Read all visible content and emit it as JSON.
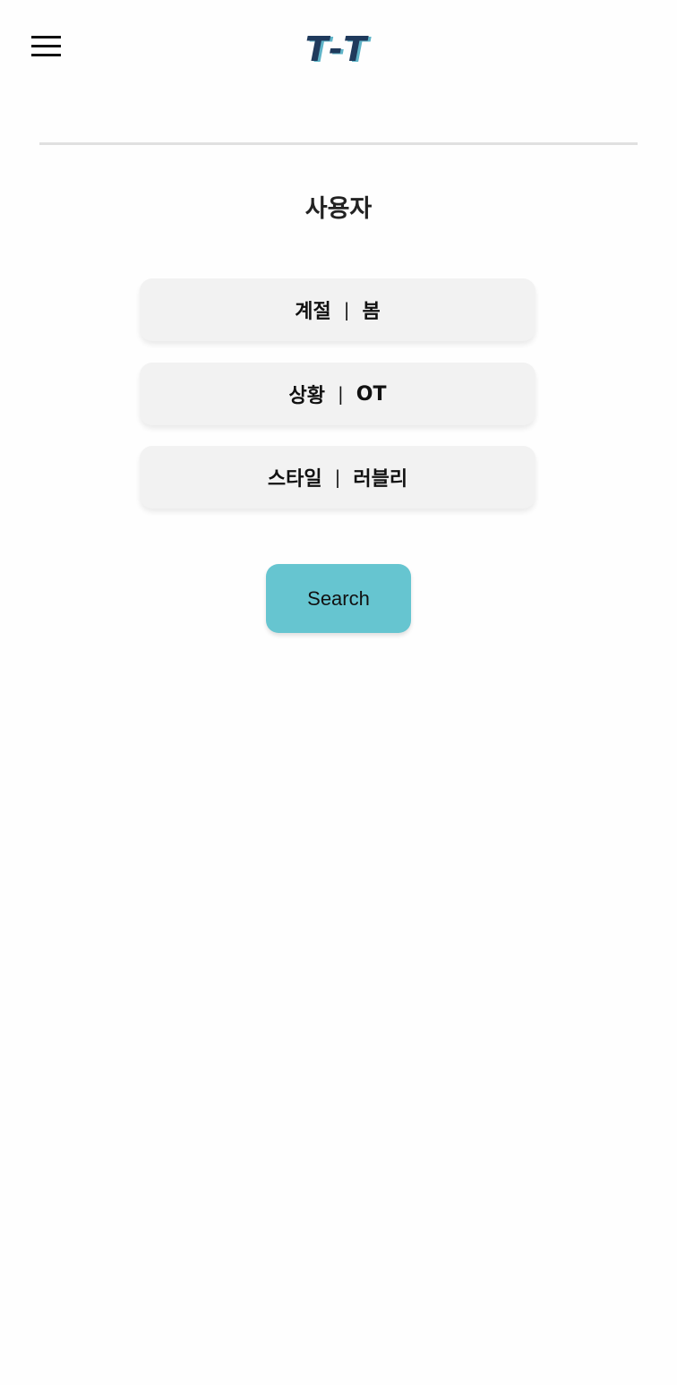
{
  "header": {
    "menu_icon": "hamburger-menu-icon",
    "logo_text": "T-T",
    "logo_colors": {
      "primary": "#1f3a5c",
      "shadow": "#5fb4c8"
    }
  },
  "page": {
    "title": "사용자"
  },
  "filters": [
    {
      "label": "계절",
      "separator": "|",
      "value": "봄"
    },
    {
      "label": "상황",
      "separator": "|",
      "value": "OT"
    },
    {
      "label": "스타일",
      "separator": "|",
      "value": "러블리"
    }
  ],
  "search": {
    "label": "Search",
    "color": "#66c5d0"
  }
}
